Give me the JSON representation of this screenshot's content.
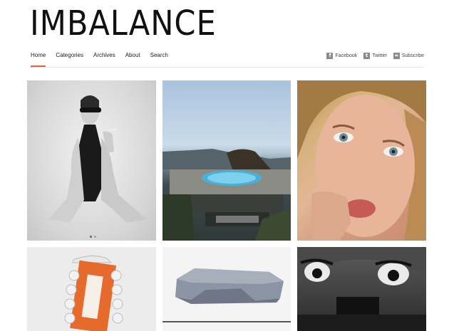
{
  "site": {
    "logo": "IMBALANCE"
  },
  "nav": {
    "items": [
      {
        "label": "Home"
      },
      {
        "label": "Categories"
      },
      {
        "label": "Archives"
      },
      {
        "label": "About"
      },
      {
        "label": "Search"
      }
    ]
  },
  "social": {
    "facebook": "Facebook",
    "twitter": "Twitter",
    "subscribe": "Subscribe"
  },
  "colors": {
    "accent": "#e8653c"
  }
}
